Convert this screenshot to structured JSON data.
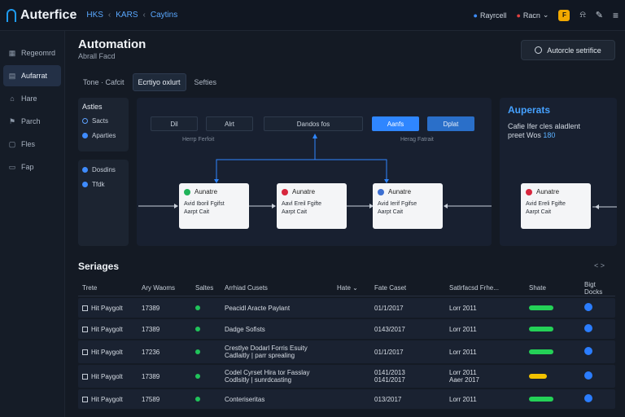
{
  "app": {
    "name": "Auterfice"
  },
  "breadcrumbs": [
    "HKS",
    "KARS",
    "Caytins"
  ],
  "topbar": {
    "user_label": "Rayrcell",
    "account_label": "Racn",
    "app_badge": "F"
  },
  "sidebar": {
    "items": [
      {
        "label": "Regeomrd",
        "icon": "grid-icon",
        "active": false
      },
      {
        "label": "Aufarrat",
        "icon": "list-icon",
        "active": true
      },
      {
        "label": "Hare",
        "icon": "home-icon",
        "active": false
      },
      {
        "label": "Parch",
        "icon": "flag-icon",
        "active": false
      },
      {
        "label": "Fles",
        "icon": "file-icon",
        "active": false
      },
      {
        "label": "Fap",
        "icon": "folder-icon",
        "active": false
      }
    ]
  },
  "header": {
    "title": "Automation",
    "subtitle": "Abrall Facd",
    "action_button": "Autorcle setrifice"
  },
  "tabs": [
    {
      "label": "Tone · Cafcit",
      "active": false
    },
    {
      "label": "Ecrtiyo oxlurt",
      "active": true
    },
    {
      "label": "Sefties",
      "active": false
    }
  ],
  "left_panel": {
    "title": "Astles",
    "items": [
      {
        "label": "Sacts",
        "filled": false
      },
      {
        "label": "Aparties",
        "filled": true
      }
    ]
  },
  "left_panel2": {
    "items": [
      {
        "label": "Dosdins",
        "filled": true
      },
      {
        "label": "Tfdk",
        "filled": true
      }
    ]
  },
  "flow": {
    "chips": [
      "Dil",
      "Alrt",
      "Dandos fos",
      "Aanfs",
      "Dplat"
    ],
    "hints": [
      "Herrp Ferfoit",
      "Herag Fatrait"
    ],
    "nodes": [
      {
        "title": "Aunatre",
        "line1": "Avid Iboril Fgifst",
        "line2": "Aarpt Cait",
        "color": "#20b35a"
      },
      {
        "title": "Aunatre",
        "line1": "Aavl Ereil Fgifte",
        "line2": "Aarpt Cait",
        "color": "#d7263d"
      },
      {
        "title": "Aunatre",
        "line1": "Avid Ierif Fgifse",
        "line2": "Aarpt Cait",
        "color": "#3d6fd1"
      },
      {
        "title": "Aunatre",
        "line1": "Avid Ereli Fgifte",
        "line2": "Aarpt Cait",
        "color": "#d7263d"
      }
    ]
  },
  "right_panel": {
    "title": "Auperats",
    "text1": "Cafie Ifer cles aladlent",
    "text2": "preet Wos",
    "highlight": "180"
  },
  "services": {
    "title": "Seriages",
    "pager": "< >",
    "columns": [
      "Trete",
      "Ary Waoms",
      "Saltes",
      "Arrhiad Cusets",
      "Hate",
      "Fate Caset",
      "Satlrfacsd Frhe...",
      "Shate",
      "Bigt Docks"
    ],
    "rows": [
      {
        "name": "Hit Paygolt",
        "id": "17389",
        "details": [
          "Peacidl Aracte Paylant"
        ],
        "date": [
          "01/1/2017"
        ],
        "time": [
          "Lorr 2011"
        ],
        "pill": "#24d157"
      },
      {
        "name": "Hit Paygolt",
        "id": "17389",
        "details": [
          "Dadge Sofists"
        ],
        "date": [
          "0143/2017"
        ],
        "time": [
          "Lorr 2011"
        ],
        "pill": "#24d157"
      },
      {
        "name": "Hit Paygolt",
        "id": "17236",
        "details": [
          "Crestlye Dodarl Forris Esuity",
          "Cadlaitly | parr sprealing"
        ],
        "date": [
          "01/1/2017"
        ],
        "time": [
          "Lorr 2011"
        ],
        "pill": "#24d157"
      },
      {
        "name": "Hit Paygolt",
        "id": "17389",
        "details": [
          "Codel Cyrset Hira tor Fasslay",
          "Codlsitly | sunrdcasting"
        ],
        "date": [
          "0141/2013",
          "0141/2017"
        ],
        "time": [
          "Lorr 2011",
          "Aaer 2017"
        ],
        "pill": "#f2c200"
      },
      {
        "name": "Hit Paygolt",
        "id": "17589",
        "details": [
          "Conteriseritas"
        ],
        "date": [
          "013/2017"
        ],
        "time": [
          "Lorr 2011"
        ],
        "pill": "#24d157"
      }
    ]
  },
  "colors": {
    "accent": "#2f86ff",
    "success": "#24d157",
    "warning": "#f2c200",
    "danger": "#d7263d"
  }
}
